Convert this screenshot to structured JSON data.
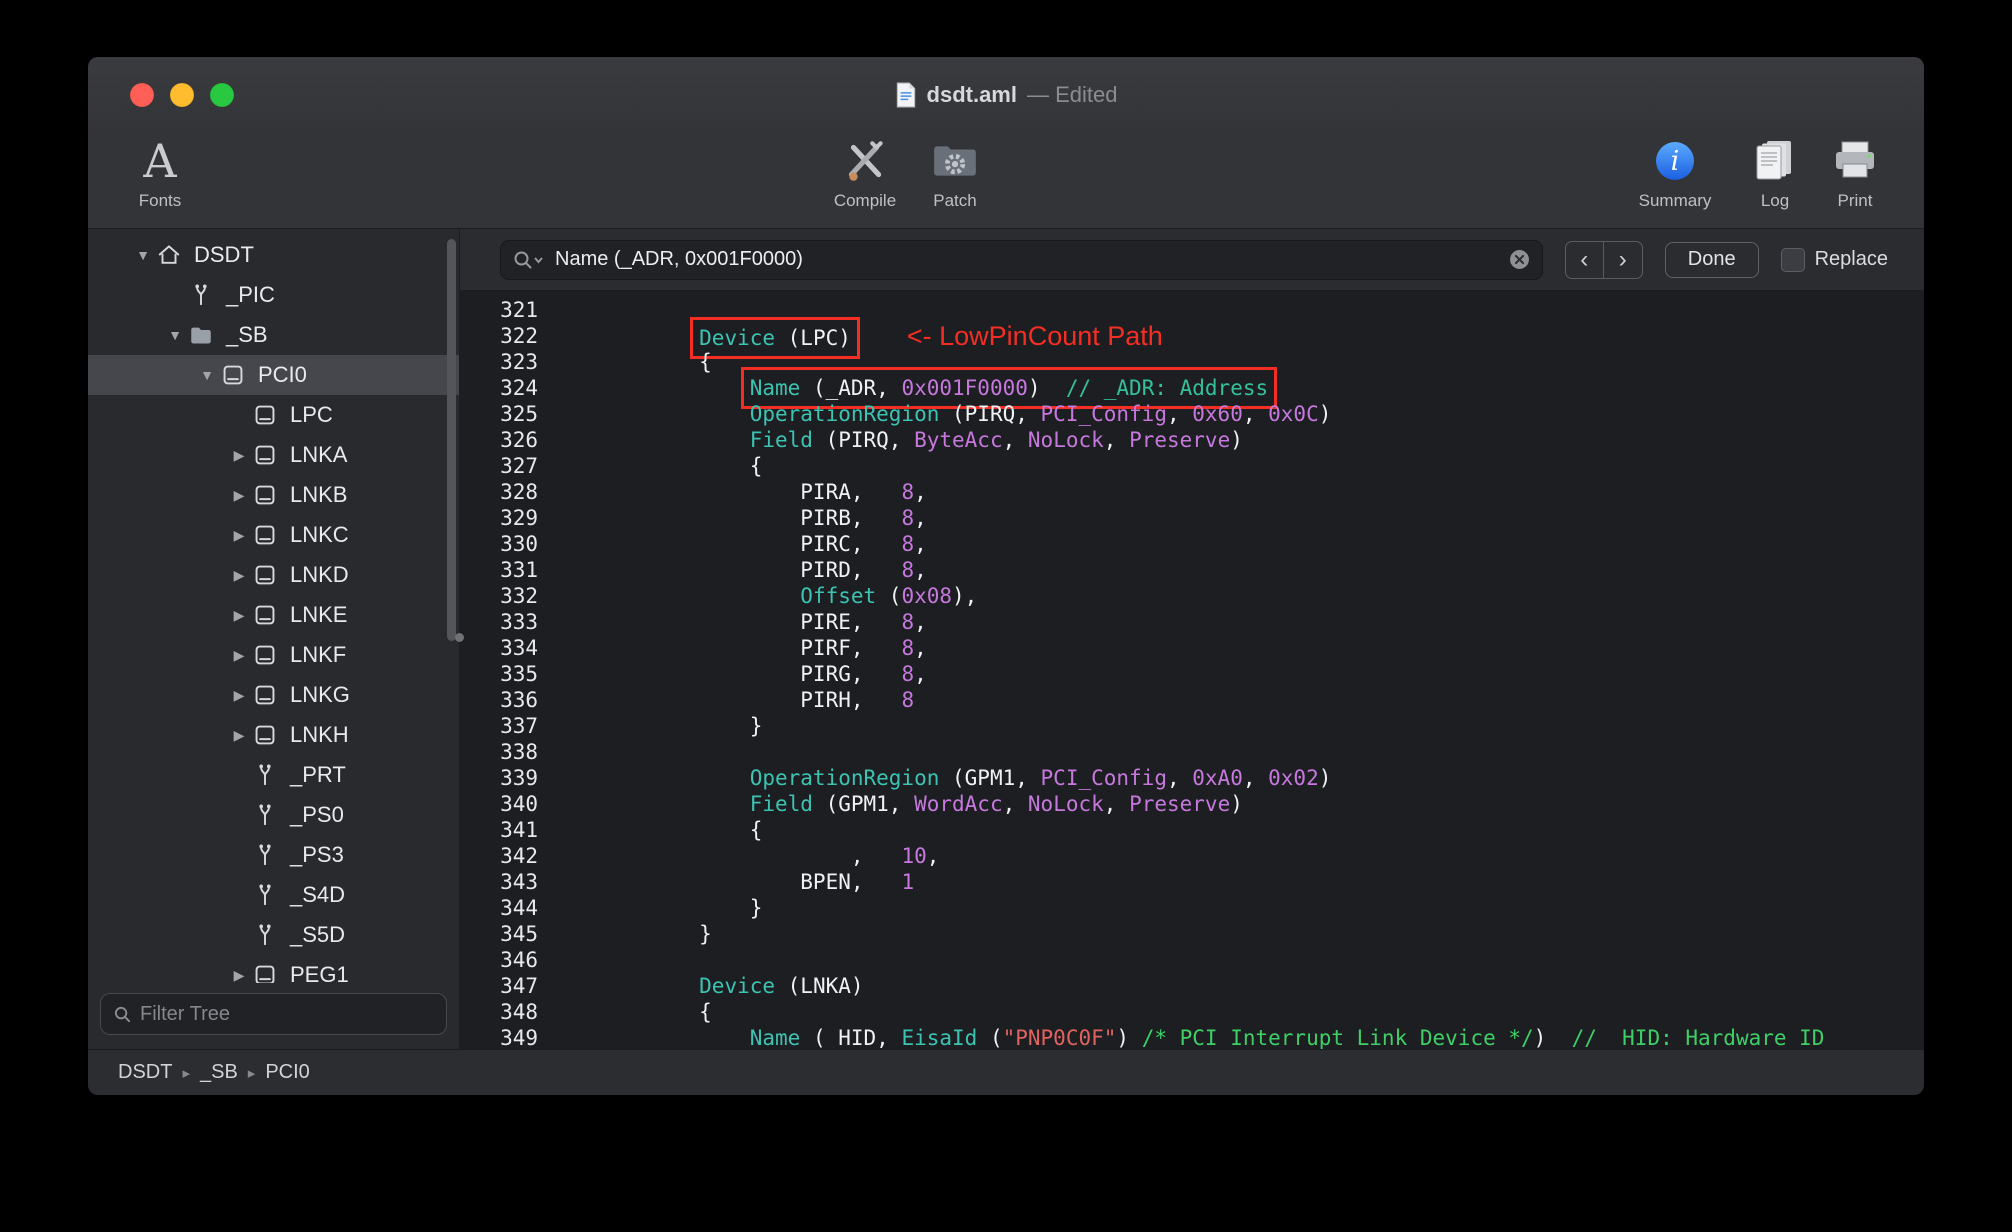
{
  "colors": {
    "keyword": "#3cc3b2",
    "value": "#c678dd",
    "string": "#e0635f",
    "comment_green": "#3ecf66",
    "comment_teal": "#35c09c",
    "plain": "#f0f1f4",
    "line_number": "#e8e9eb",
    "annotation_red": "#f42e22",
    "traffic_close": "#ff5f57",
    "traffic_minimize": "#febc2e",
    "traffic_zoom": "#28c840"
  },
  "window": {
    "title": "dsdt.aml",
    "edited": "— Edited"
  },
  "toolbar": {
    "fonts": "Fonts",
    "compile": "Compile",
    "patch": "Patch",
    "summary": "Summary",
    "log": "Log",
    "print": "Print"
  },
  "sidebar": {
    "filter_placeholder": "Filter Tree",
    "items": [
      {
        "label": "DSDT",
        "icon": "house",
        "level": 0,
        "disclosure": "open",
        "selected": false
      },
      {
        "label": "_PIC",
        "icon": "method",
        "level": 1,
        "disclosure": "none",
        "selected": false
      },
      {
        "label": "_SB",
        "icon": "folder",
        "level": 1,
        "disclosure": "open",
        "selected": false
      },
      {
        "label": "PCI0",
        "icon": "device",
        "level": 2,
        "disclosure": "open",
        "selected": true
      },
      {
        "label": "LPC",
        "icon": "device",
        "level": 3,
        "disclosure": "none",
        "selected": false
      },
      {
        "label": "LNKA",
        "icon": "device",
        "level": 3,
        "disclosure": "closed",
        "selected": false
      },
      {
        "label": "LNKB",
        "icon": "device",
        "level": 3,
        "disclosure": "closed",
        "selected": false
      },
      {
        "label": "LNKC",
        "icon": "device",
        "level": 3,
        "disclosure": "closed",
        "selected": false
      },
      {
        "label": "LNKD",
        "icon": "device",
        "level": 3,
        "disclosure": "closed",
        "selected": false
      },
      {
        "label": "LNKE",
        "icon": "device",
        "level": 3,
        "disclosure": "closed",
        "selected": false
      },
      {
        "label": "LNKF",
        "icon": "device",
        "level": 3,
        "disclosure": "closed",
        "selected": false
      },
      {
        "label": "LNKG",
        "icon": "device",
        "level": 3,
        "disclosure": "closed",
        "selected": false
      },
      {
        "label": "LNKH",
        "icon": "device",
        "level": 3,
        "disclosure": "closed",
        "selected": false
      },
      {
        "label": "_PRT",
        "icon": "method",
        "level": 3,
        "disclosure": "none",
        "selected": false
      },
      {
        "label": "_PS0",
        "icon": "method",
        "level": 3,
        "disclosure": "none",
        "selected": false
      },
      {
        "label": "_PS3",
        "icon": "method",
        "level": 3,
        "disclosure": "none",
        "selected": false
      },
      {
        "label": "_S4D",
        "icon": "method",
        "level": 3,
        "disclosure": "none",
        "selected": false
      },
      {
        "label": "_S5D",
        "icon": "method",
        "level": 3,
        "disclosure": "none",
        "selected": false
      },
      {
        "label": "PEG1",
        "icon": "device",
        "level": 3,
        "disclosure": "closed",
        "selected": false
      }
    ]
  },
  "search": {
    "query": "Name (_ADR, 0x001F0000)",
    "done": "Done",
    "replace": "Replace"
  },
  "statusbar": {
    "path": [
      "DSDT",
      "_SB",
      "PCI0"
    ]
  },
  "editor": {
    "lines": [
      {
        "num": 321,
        "tokens": []
      },
      {
        "num": 322,
        "tokens": [
          [
            "        ",
            "p"
          ],
          [
            "Device",
            "k"
          ],
          [
            " (LPC)",
            "p"
          ]
        ],
        "box": [
          1,
          2
        ],
        "annotation": "<- LowPinCount Path"
      },
      {
        "num": 323,
        "tokens": [
          [
            "        {",
            "p"
          ]
        ]
      },
      {
        "num": 324,
        "tokens": [
          [
            "            ",
            "p"
          ],
          [
            "Name",
            "k"
          ],
          [
            " (_ADR, ",
            "p"
          ],
          [
            "0x001F0000",
            "v"
          ],
          [
            ")",
            "p"
          ],
          [
            "  ",
            "p"
          ],
          [
            "// _ADR: Address",
            "ct"
          ]
        ],
        "box": [
          1,
          6
        ]
      },
      {
        "num": 325,
        "tokens": [
          [
            "            ",
            "p"
          ],
          [
            "OperationRegion",
            "k"
          ],
          [
            " (PIRQ, ",
            "p"
          ],
          [
            "PCI_Config",
            "v"
          ],
          [
            ", ",
            "p"
          ],
          [
            "0x60",
            "v"
          ],
          [
            ", ",
            "p"
          ],
          [
            "0x0C",
            "v"
          ],
          [
            ")",
            "p"
          ]
        ]
      },
      {
        "num": 326,
        "tokens": [
          [
            "            ",
            "p"
          ],
          [
            "Field",
            "k"
          ],
          [
            " (PIRQ, ",
            "p"
          ],
          [
            "ByteAcc",
            "v"
          ],
          [
            ", ",
            "p"
          ],
          [
            "NoLock",
            "v"
          ],
          [
            ", ",
            "p"
          ],
          [
            "Preserve",
            "v"
          ],
          [
            ")",
            "p"
          ]
        ]
      },
      {
        "num": 327,
        "tokens": [
          [
            "            {",
            "p"
          ]
        ]
      },
      {
        "num": 328,
        "tokens": [
          [
            "                PIRA,   ",
            "p"
          ],
          [
            "8",
            "v"
          ],
          [
            ",",
            "p"
          ]
        ]
      },
      {
        "num": 329,
        "tokens": [
          [
            "                PIRB,   ",
            "p"
          ],
          [
            "8",
            "v"
          ],
          [
            ",",
            "p"
          ]
        ]
      },
      {
        "num": 330,
        "tokens": [
          [
            "                PIRC,   ",
            "p"
          ],
          [
            "8",
            "v"
          ],
          [
            ",",
            "p"
          ]
        ]
      },
      {
        "num": 331,
        "tokens": [
          [
            "                PIRD,   ",
            "p"
          ],
          [
            "8",
            "v"
          ],
          [
            ",",
            "p"
          ]
        ]
      },
      {
        "num": 332,
        "tokens": [
          [
            "                ",
            "p"
          ],
          [
            "Offset",
            "k"
          ],
          [
            " (",
            "p"
          ],
          [
            "0x08",
            "v"
          ],
          [
            "),",
            "p"
          ]
        ]
      },
      {
        "num": 333,
        "tokens": [
          [
            "                PIRE,   ",
            "p"
          ],
          [
            "8",
            "v"
          ],
          [
            ",",
            "p"
          ]
        ]
      },
      {
        "num": 334,
        "tokens": [
          [
            "                PIRF,   ",
            "p"
          ],
          [
            "8",
            "v"
          ],
          [
            ",",
            "p"
          ]
        ]
      },
      {
        "num": 335,
        "tokens": [
          [
            "                PIRG,   ",
            "p"
          ],
          [
            "8",
            "v"
          ],
          [
            ",",
            "p"
          ]
        ]
      },
      {
        "num": 336,
        "tokens": [
          [
            "                PIRH,   ",
            "p"
          ],
          [
            "8",
            "v"
          ]
        ]
      },
      {
        "num": 337,
        "tokens": [
          [
            "            }",
            "p"
          ]
        ]
      },
      {
        "num": 338,
        "tokens": []
      },
      {
        "num": 339,
        "tokens": [
          [
            "            ",
            "p"
          ],
          [
            "OperationRegion",
            "k"
          ],
          [
            " (GPM1, ",
            "p"
          ],
          [
            "PCI_Config",
            "v"
          ],
          [
            ", ",
            "p"
          ],
          [
            "0xA0",
            "v"
          ],
          [
            ", ",
            "p"
          ],
          [
            "0x02",
            "v"
          ],
          [
            ")",
            "p"
          ]
        ]
      },
      {
        "num": 340,
        "tokens": [
          [
            "            ",
            "p"
          ],
          [
            "Field",
            "k"
          ],
          [
            " (GPM1, ",
            "p"
          ],
          [
            "WordAcc",
            "v"
          ],
          [
            ", ",
            "p"
          ],
          [
            "NoLock",
            "v"
          ],
          [
            ", ",
            "p"
          ],
          [
            "Preserve",
            "v"
          ],
          [
            ")",
            "p"
          ]
        ]
      },
      {
        "num": 341,
        "tokens": [
          [
            "            {",
            "p"
          ]
        ]
      },
      {
        "num": 342,
        "tokens": [
          [
            "                    ,   ",
            "p"
          ],
          [
            "10",
            "v"
          ],
          [
            ",",
            "p"
          ]
        ]
      },
      {
        "num": 343,
        "tokens": [
          [
            "                BPEN,   ",
            "p"
          ],
          [
            "1",
            "v"
          ]
        ]
      },
      {
        "num": 344,
        "tokens": [
          [
            "            }",
            "p"
          ]
        ]
      },
      {
        "num": 345,
        "tokens": [
          [
            "        }",
            "p"
          ]
        ]
      },
      {
        "num": 346,
        "tokens": []
      },
      {
        "num": 347,
        "tokens": [
          [
            "        ",
            "p"
          ],
          [
            "Device",
            "k"
          ],
          [
            " (LNKA)",
            "p"
          ]
        ]
      },
      {
        "num": 348,
        "tokens": [
          [
            "        {",
            "p"
          ]
        ]
      },
      {
        "num": 349,
        "tokens": [
          [
            "            ",
            "p"
          ],
          [
            "Name",
            "k"
          ],
          [
            " (_HID, ",
            "p"
          ],
          [
            "EisaId",
            "k"
          ],
          [
            " (",
            "p"
          ],
          [
            "\"PNP0C0F\"",
            "s"
          ],
          [
            ")",
            "p"
          ],
          [
            " ",
            "p"
          ],
          [
            "/* PCI Interrupt Link Device */",
            "cg"
          ],
          [
            ")  ",
            "p"
          ],
          [
            "// _HID: Hardware ID",
            "cg"
          ]
        ]
      }
    ]
  }
}
